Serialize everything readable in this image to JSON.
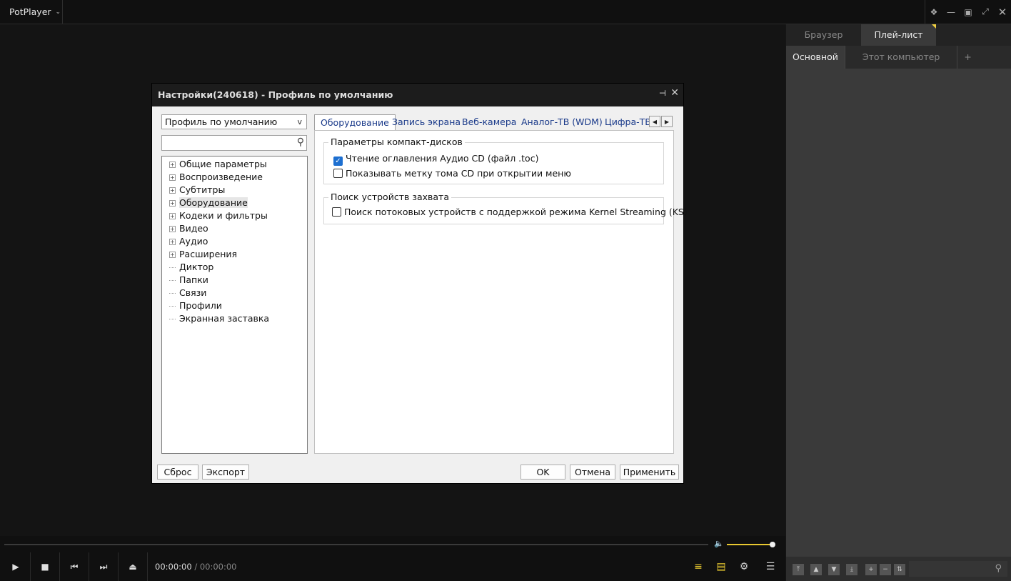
{
  "app": {
    "name": "PotPlayer"
  },
  "window_controls": [
    "pin",
    "minimize",
    "maximize",
    "fullscreen",
    "close"
  ],
  "right_panel": {
    "tabs": [
      {
        "label": "Браузер",
        "active": false
      },
      {
        "label": "Плей-лист",
        "active": true
      }
    ],
    "subtabs": [
      {
        "label": "Основной",
        "active": true
      },
      {
        "label": "Этот компьютер",
        "active": false
      },
      {
        "label": "+",
        "active": false
      }
    ]
  },
  "player": {
    "time_current": "00:00:00",
    "time_separator": "/",
    "time_total": "00:00:00",
    "volume_level": 1.0,
    "accent_color": "#e8c830"
  },
  "dialog": {
    "title": "Настройки(240618) - Профиль по умолчанию",
    "profile_value": "Профиль по умолчанию",
    "profile_arrow": "v",
    "search_placeholder": "",
    "tree": [
      {
        "label": "Общие параметры",
        "expandable": true
      },
      {
        "label": "Воспроизведение",
        "expandable": true
      },
      {
        "label": "Субтитры",
        "expandable": true
      },
      {
        "label": "Оборудование",
        "expandable": true,
        "selected": true
      },
      {
        "label": "Кодеки и фильтры",
        "expandable": true
      },
      {
        "label": "Видео",
        "expandable": true
      },
      {
        "label": "Аудио",
        "expandable": true
      },
      {
        "label": "Расширения",
        "expandable": true
      },
      {
        "label": "Диктор",
        "expandable": false
      },
      {
        "label": "Папки",
        "expandable": false
      },
      {
        "label": "Связи",
        "expandable": false
      },
      {
        "label": "Профили",
        "expandable": false
      },
      {
        "label": "Экранная заставка",
        "expandable": false
      }
    ],
    "tabs": [
      {
        "label": "Оборудование",
        "active": true
      },
      {
        "label": "Запись экрана",
        "active": false
      },
      {
        "label": "Веб-камера",
        "active": false
      },
      {
        "label": "Аналог-ТВ (WDM)",
        "active": false
      },
      {
        "label": "Цифра-ТВ",
        "active": false
      }
    ],
    "groups": [
      {
        "label": "Параметры компакт-дисков",
        "options": [
          {
            "label": "Чтение оглавления Аудио CD (файл .toc)",
            "checked": true
          },
          {
            "label": "Показывать метку тома CD при открытии меню",
            "checked": false
          }
        ]
      },
      {
        "label": "Поиск устройств захвата",
        "options": [
          {
            "label": "Поиск потоковых устройств с поддержкой режима Kernel Streaming (KS)",
            "checked": false
          }
        ]
      }
    ],
    "buttons": {
      "reset": "Сброс",
      "export": "Экспорт",
      "ok": "OK",
      "cancel": "Отмена",
      "apply": "Применить"
    }
  }
}
